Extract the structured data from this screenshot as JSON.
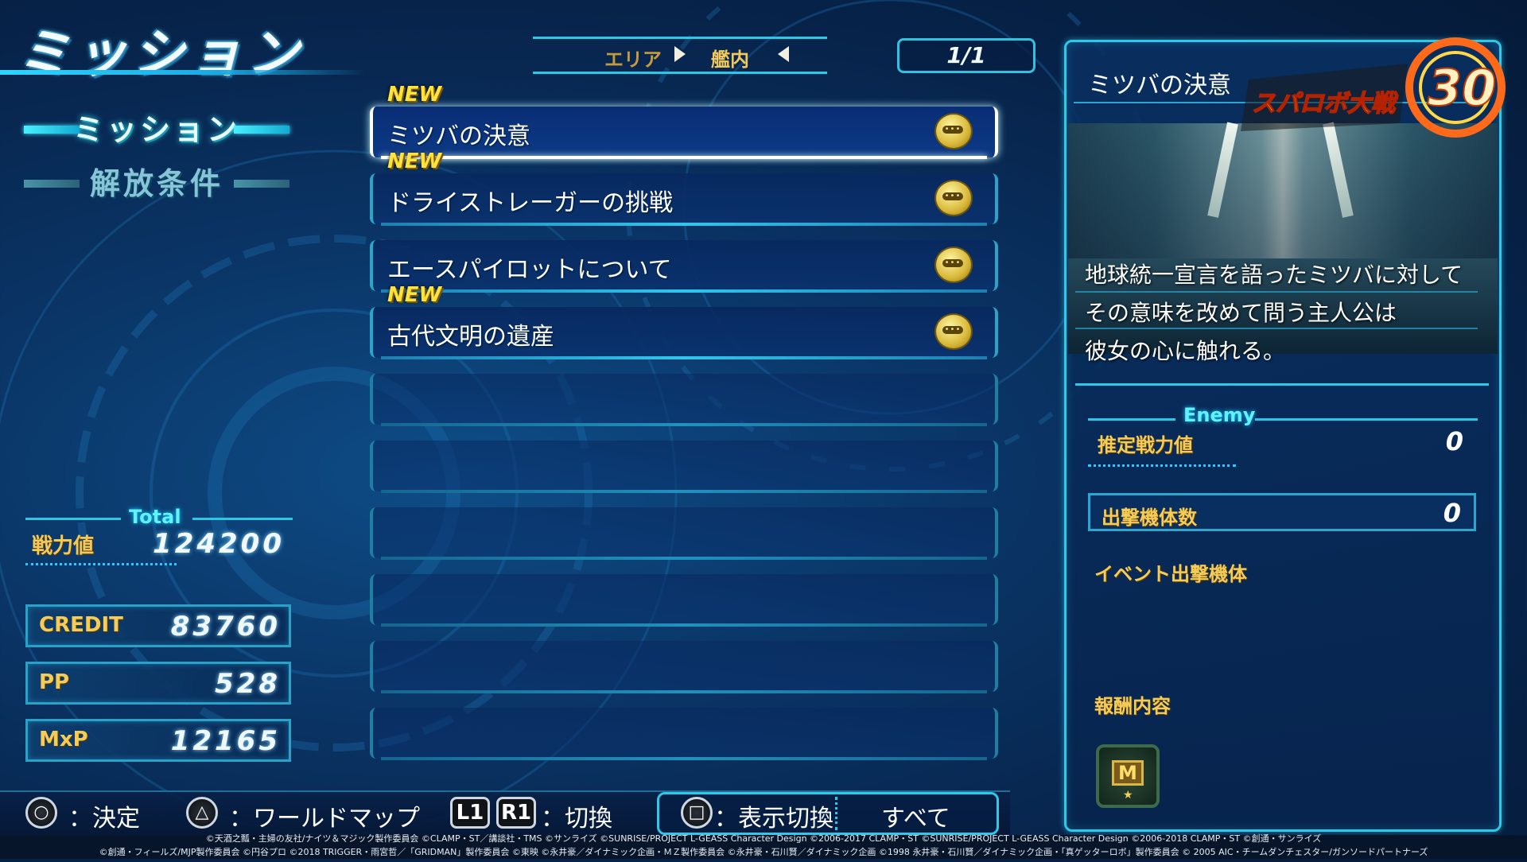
{
  "title": "ミッション",
  "side_tabs": [
    {
      "label": "ミッション",
      "active": true
    },
    {
      "label": "解放条件",
      "active": false
    }
  ],
  "totals": {
    "header": "Total",
    "power_label": "戦力値",
    "power_value": "124200",
    "stats": [
      {
        "label": "CREDIT",
        "value": "83760"
      },
      {
        "label": "PP",
        "value": "528"
      },
      {
        "label": "MxP",
        "value": "12165"
      }
    ]
  },
  "area": {
    "label": "エリア",
    "value": "艦内"
  },
  "page_indicator": "1/1",
  "missions": [
    {
      "name": "ミツバの決意",
      "new_label": "NEW",
      "selected": true
    },
    {
      "name": "ドライストレーガーの挑戦",
      "new_label": "NEW",
      "selected": false
    },
    {
      "name": "エースパイロットについて",
      "new_label": "",
      "selected": false
    },
    {
      "name": "古代文明の遺産",
      "new_label": "NEW",
      "selected": false
    }
  ],
  "empty_slots": 6,
  "detail": {
    "title": "ミツバの決意",
    "logo_text": "スーパーロボット大戦30",
    "description": [
      "地球統一宣言を語ったミツバに対して",
      "その意味を改めて問う主人公は",
      "彼女の心に触れる。"
    ],
    "enemy_header": "Enemy",
    "est_power_label": "推定戦力値",
    "est_power_value": "0",
    "sortie_label": "出撃機体数",
    "sortie_value": "0",
    "event_label": "イベント出撃機体",
    "reward_label": "報酬内容",
    "reward_icon_letter": "M"
  },
  "controls": [
    {
      "icon": "circle-button",
      "glyph": "○",
      "label": "：決定"
    },
    {
      "icon": "triangle-button",
      "glyph": "△",
      "label": "：ワールドマップ"
    },
    {
      "icon": "l1-button",
      "glyph": "L1"
    },
    {
      "icon": "r1-button",
      "glyph": "R1",
      "label": "：切換"
    },
    {
      "icon": "square-button",
      "glyph": "□",
      "label": "：表示切換"
    }
  ],
  "filter_value": "すべて",
  "copyright": [
    "©天酒之瓢・主婦の友社/ナイツ＆マジック製作委員会 ©CLAMP・ST／講談社・TMS ©サンライズ ©SUNRISE/PROJECT L-GEASS Character Design ©2006-2017 CLAMP・ST ©SUNRISE/PROJECT L-GEASS Character Design ©2006-2018 CLAMP・ST ©創通・サンライズ",
    "©創通・フィールズ/MJP製作委員会 ©円谷プロ ©2018 TRIGGER・雨宮哲／「GRIDMAN」製作委員会 ©東映 ©永井豪／ダイナミック企画・ＭＺ製作委員会 ©永井豪・石川賢／ダイナミック企画 ©1998 永井豪・石川賢／ダイナミック企画・「真ゲッターロボ」製作委員会 © 2005 AIC・チームダンチェスター/ガンソードパートナーズ"
  ],
  "colors": {
    "accent_cyan": "#2ec8e8",
    "gold_label": "#f5cc57",
    "new_badge": "#ffe23a",
    "bg_dark": "#051a38"
  }
}
